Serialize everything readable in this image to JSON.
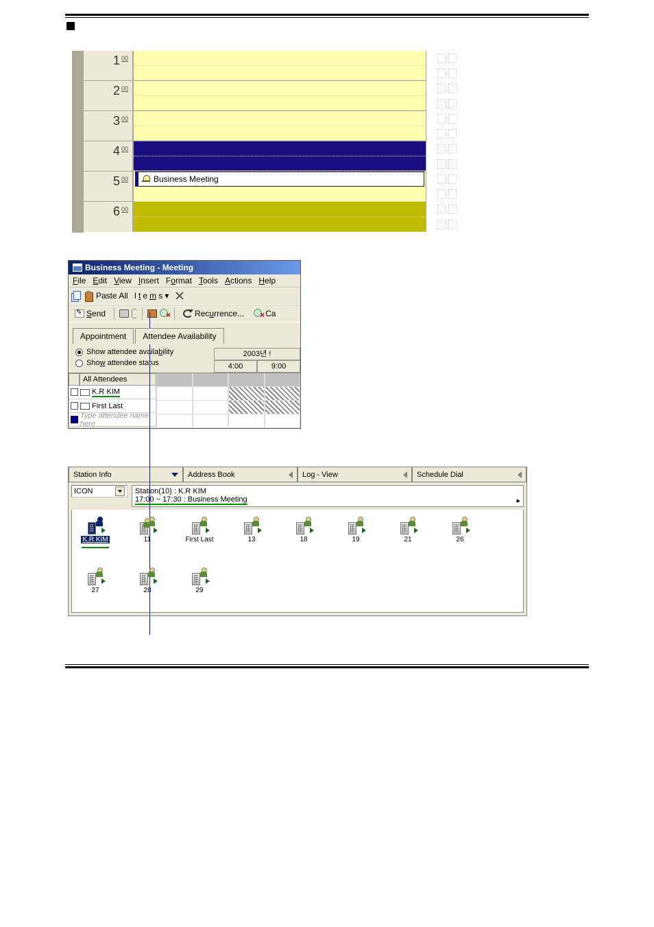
{
  "calendar": {
    "hours": [
      {
        "h": "1",
        "m": "00",
        "slots": [
          "free",
          "free"
        ]
      },
      {
        "h": "2",
        "m": "00",
        "slots": [
          "free",
          "free"
        ]
      },
      {
        "h": "3",
        "m": "00",
        "slots": [
          "free",
          "free"
        ]
      },
      {
        "h": "4",
        "m": "00",
        "slots": [
          "busy",
          "busy"
        ]
      },
      {
        "h": "5",
        "m": "00",
        "slots": [
          "appointment",
          "free"
        ],
        "appointment_text": "Business Meeting"
      },
      {
        "h": "6",
        "m": "00",
        "slots": [
          "olive",
          "olive"
        ]
      }
    ]
  },
  "meeting_window": {
    "title": "Business Meeting - Meeting",
    "menu": {
      "file": "File",
      "edit": "Edit",
      "view": "View",
      "insert": "Insert",
      "format": "Format",
      "tools": "Tools",
      "actions": "Actions",
      "help": "Help"
    },
    "toolbar1": {
      "paste_all": "Paste All",
      "items": "Items"
    },
    "toolbar2": {
      "send": "Send",
      "recurrence": "Recurrence...",
      "cancel_prefix": "Ca"
    },
    "tabs": {
      "appointment": "Appointment",
      "attendee": "Attendee Availability"
    },
    "options": {
      "availability": "Show attendee availability",
      "status": "Show attendee status"
    },
    "grid": {
      "all_attendees_label": "All Attendees",
      "date_hdr": "2003년 !",
      "time_hdrs": [
        "4:00",
        "9:00"
      ],
      "rows": [
        {
          "name": "K.R KIM",
          "green": true
        },
        {
          "name": "First Last",
          "green": false
        }
      ],
      "placeholder": "Type attendee name here"
    }
  },
  "station_panel": {
    "tabs": {
      "info": "Station Info",
      "address": "Address Book",
      "log": "Log - View",
      "schedule": "Schedule Dial"
    },
    "selector": "ICON",
    "info_line1": "Station(10) :  K.R KIM",
    "info_line2": "17:00 ~ 17:30 : Business Meeting",
    "icons": [
      {
        "label": "K.R KIM",
        "sel": true
      },
      {
        "label": "11",
        "two": true
      },
      {
        "label": "First Last"
      },
      {
        "label": "13"
      },
      {
        "label": "18"
      },
      {
        "label": "19"
      },
      {
        "label": "21"
      },
      {
        "label": "26"
      },
      {
        "label": "27"
      },
      {
        "label": "28"
      },
      {
        "label": "29"
      }
    ]
  }
}
